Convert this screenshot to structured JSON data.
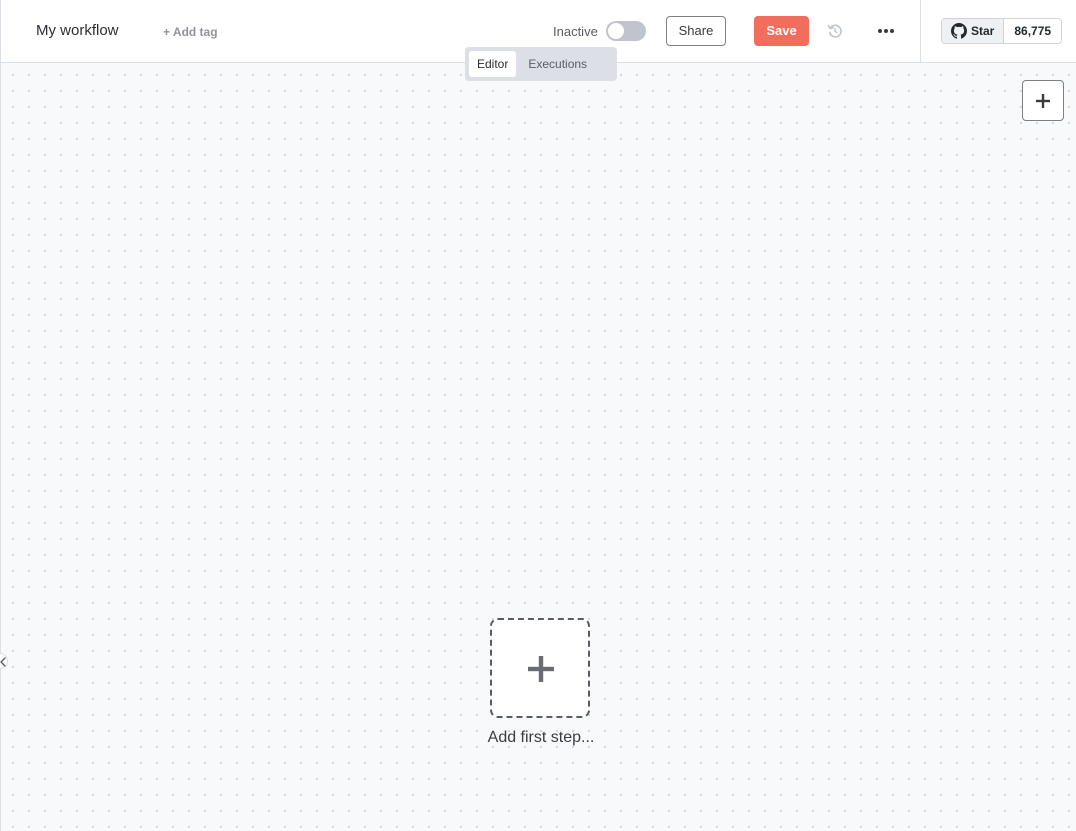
{
  "header": {
    "workflow_name": "My workflow",
    "add_tag_label": "+ Add tag",
    "status_label": "Inactive",
    "active": false,
    "share_label": "Share",
    "save_label": "Save"
  },
  "github": {
    "star_label": "Star",
    "star_count": "86,775"
  },
  "tabs": [
    {
      "label": "Editor",
      "active": true
    },
    {
      "label": "Executions",
      "active": false
    }
  ],
  "canvas": {
    "add_first_step_label": "Add first step..."
  },
  "icons": {
    "history": "history-icon",
    "more": "more-horizontal-icon",
    "add": "plus-icon",
    "github": "github-icon",
    "collapse": "chevron-left-icon"
  },
  "colors": {
    "save_button": "#f26d5b",
    "canvas_background": "#f8f9fb",
    "toggle_off": "#c0c4cc"
  }
}
